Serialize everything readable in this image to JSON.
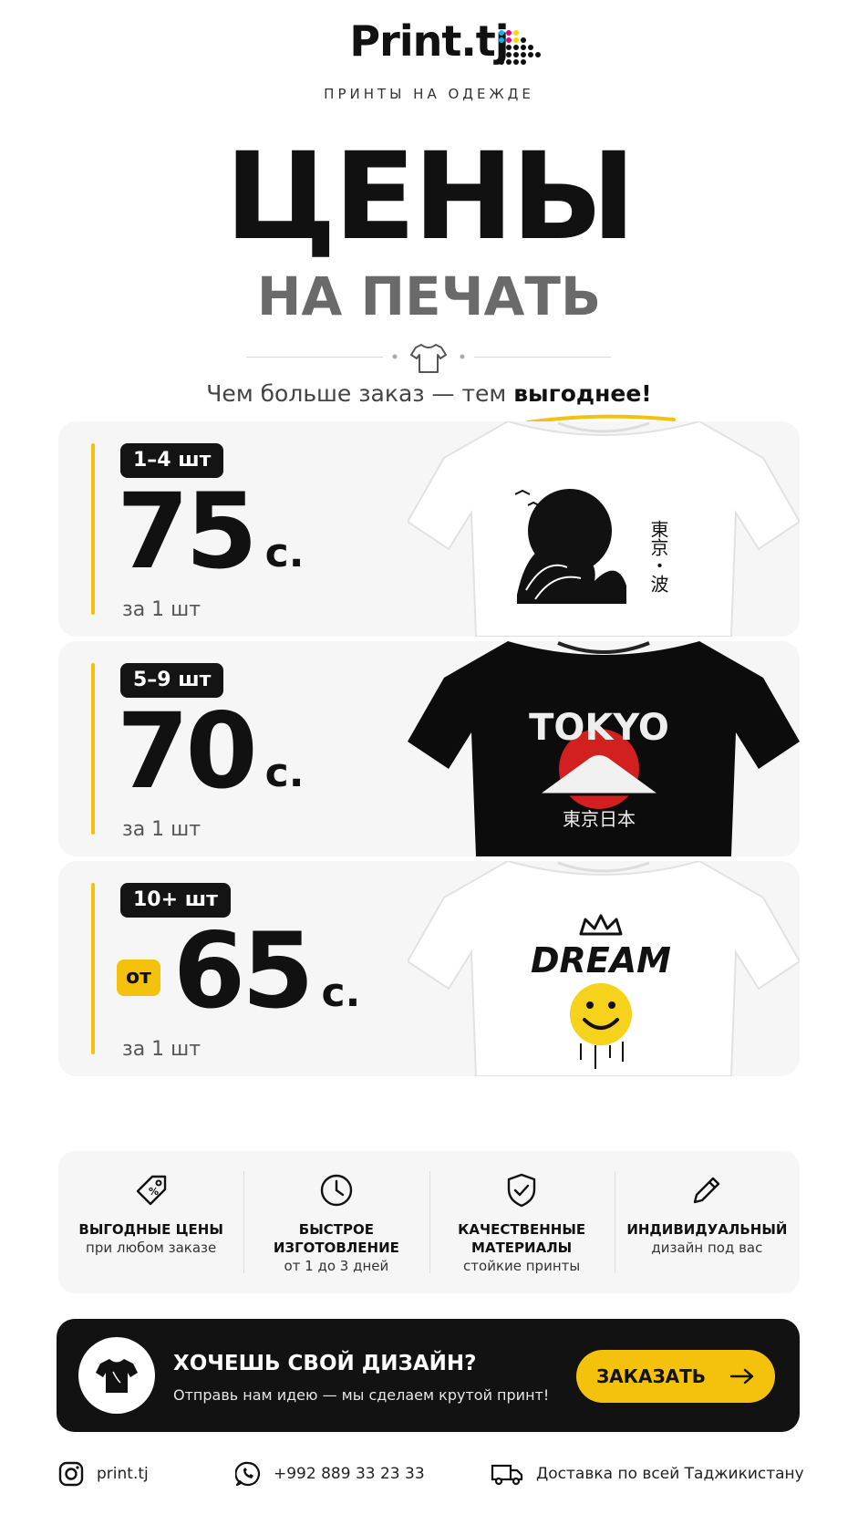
{
  "brand": {
    "logo_text": "Print.tj",
    "tagline": "ПРИНТЫ НА ОДЕЖДЕ"
  },
  "header": {
    "title": "ЦЕНЫ",
    "subtitle": "НА ПЕЧАТЬ",
    "slogan_prefix": "Чем больше заказ — тем",
    "slogan_highlight": "выгоднее!"
  },
  "colors": {
    "accent_yellow": "#f4c20d",
    "dark": "#121212",
    "card_bg": "#f6f6f6",
    "subtitle_gray": "#6a6a6a"
  },
  "pricing": [
    {
      "qty": "1–4 шт",
      "prefix": "",
      "price": "75",
      "currency": "с.",
      "per_unit": "за 1 шт",
      "shirt": "white-wave-shirt"
    },
    {
      "qty": "5–9 шт",
      "prefix": "",
      "price": "70",
      "currency": "с.",
      "per_unit": "за 1 шт",
      "shirt": "black-tokyo-shirt"
    },
    {
      "qty": "10+ шт",
      "prefix": "от",
      "price": "65",
      "currency": "с.",
      "per_unit": "за 1 шт",
      "shirt": "white-dream-shirt"
    }
  ],
  "shirt_prints": {
    "tokyo_text": "TOKYO",
    "tokyo_jp": "東京日本",
    "wave_jp": "東京・波",
    "dream_text": "DREAM"
  },
  "features": [
    {
      "icon": "price-tag-icon",
      "title": "ВЫГОДНЫЕ ЦЕНЫ",
      "sub": "при любом заказе"
    },
    {
      "icon": "clock-icon",
      "title": "БЫСТРОЕ ИЗГОТОВЛЕНИЕ",
      "sub": "от 1 до 3 дней"
    },
    {
      "icon": "shield-check-icon",
      "title": "КАЧЕСТВЕННЫЕ МАТЕРИАЛЫ",
      "sub": "стойкие принты"
    },
    {
      "icon": "pencil-icon",
      "title": "ИНДИВИДУАЛЬНЫЙ",
      "sub": "дизайн под вас"
    }
  ],
  "cta": {
    "title": "ХОЧЕШЬ СВОЙ ДИЗАЙН?",
    "subtitle": "Отправь нам идею — мы сделаем крутой принт!",
    "button_label": "ЗАКАЗАТЬ",
    "icon": "tshirt-icon"
  },
  "footer": {
    "instagram": "print.tj",
    "phone": "+992 889 33 23 33",
    "delivery": "Доставка по всей Таджикистану"
  }
}
